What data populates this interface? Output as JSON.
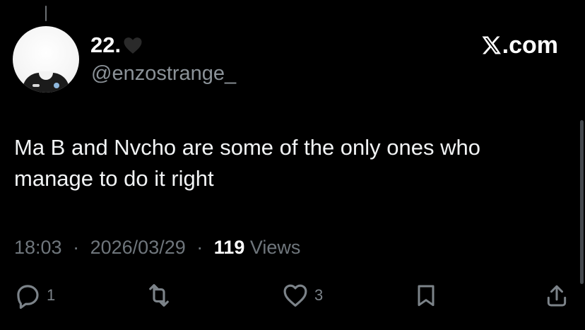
{
  "post": {
    "display_name": "22.",
    "display_name_emoji": "black-heart",
    "handle": "@enzostrange_",
    "brand": ".com",
    "text_lines": [
      "Ma B and Nvcho are some of the only ones who",
      "manage to do it right"
    ],
    "time": "18:03",
    "date": "2026/03/29",
    "separator": "·",
    "views_count": "119",
    "views_label": "Views"
  },
  "actions": {
    "reply_count": "1",
    "like_count": "3"
  },
  "icons": {
    "reply": "reply-icon",
    "retweet": "retweet-icon",
    "like": "heart-icon",
    "bookmark": "bookmark-icon",
    "share": "share-icon",
    "brand": "x-logo-icon"
  },
  "colors": {
    "background": "#000000",
    "text": "#f1f3f4",
    "muted": "#6f767c",
    "accent": "#ffffff"
  }
}
